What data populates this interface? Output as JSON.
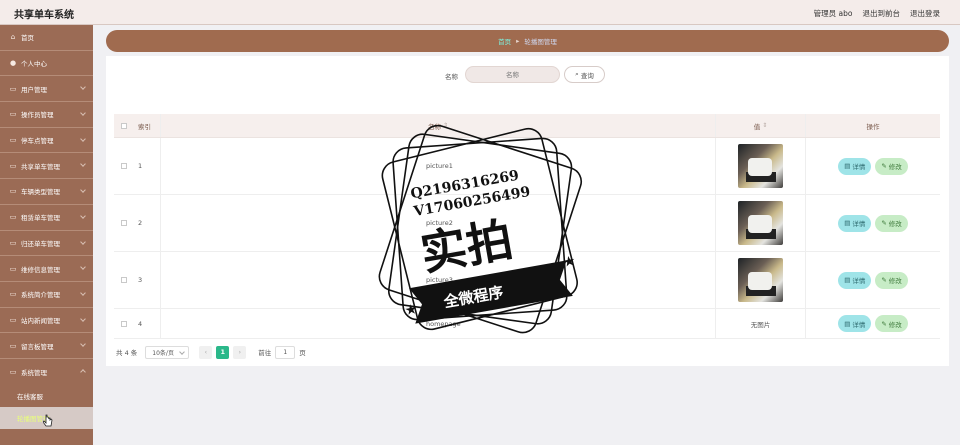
{
  "app": {
    "title": "共享单车系统"
  },
  "topbar": {
    "user": "管理员 abo",
    "front": "退出到前台",
    "logout": "退出登录"
  },
  "sidebar": {
    "items": [
      {
        "label": "首页",
        "icon": "home-icon"
      },
      {
        "label": "个人中心",
        "icon": "user-icon"
      },
      {
        "label": "用户管理",
        "icon": "folder-icon"
      },
      {
        "label": "操作员管理",
        "icon": "folder-icon"
      },
      {
        "label": "停车点管理",
        "icon": "folder-icon"
      },
      {
        "label": "共享单车管理",
        "icon": "folder-icon"
      },
      {
        "label": "车辆类型管理",
        "icon": "folder-icon"
      },
      {
        "label": "租赁单车管理",
        "icon": "folder-icon"
      },
      {
        "label": "归还单车管理",
        "icon": "folder-icon"
      },
      {
        "label": "维修信息管理",
        "icon": "folder-icon"
      },
      {
        "label": "系统简介管理",
        "icon": "folder-icon"
      },
      {
        "label": "站内新闻管理",
        "icon": "folder-icon"
      },
      {
        "label": "留言板管理",
        "icon": "folder-icon"
      },
      {
        "label": "系统管理",
        "icon": "folder-icon"
      }
    ],
    "sub_items": [
      {
        "label": "在线客服"
      },
      {
        "label": "轮播图管理"
      }
    ]
  },
  "breadcrumb": {
    "home": "首页",
    "current": "轮播图管理"
  },
  "search": {
    "label": "名称",
    "placeholder": "名称",
    "button": "查询"
  },
  "table": {
    "headers": {
      "index": "索引",
      "name": "名称",
      "value": "值",
      "ops": "操作"
    },
    "rows": [
      {
        "index": "1",
        "name": "picture1",
        "value": "image"
      },
      {
        "index": "2",
        "name": "picture2",
        "value": "image"
      },
      {
        "index": "3",
        "name": "picture3",
        "value": "image"
      },
      {
        "index": "4",
        "name": "homepage",
        "value": "无图片"
      }
    ],
    "detail_label": "详情",
    "edit_label": "修改"
  },
  "pager": {
    "total": "共 4 条",
    "size": "10条/页",
    "current": "1",
    "goto": "前往",
    "goto_value": "1",
    "unit": "页"
  },
  "watermark": {
    "line1": "Q2196316269",
    "line2": "V17060256499",
    "big": "实拍",
    "ribbon": "全微程序"
  }
}
